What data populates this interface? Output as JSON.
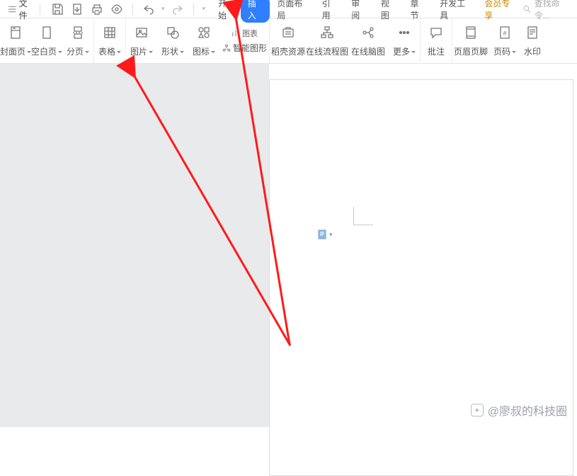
{
  "topbar": {
    "file_label": "文件",
    "search_placeholder": "查找命令..."
  },
  "tabs": {
    "start": "开始",
    "insert": "插入",
    "layout": "页面布局",
    "reference": "引用",
    "review": "审阅",
    "view": "视图",
    "chapter": "章节",
    "devtools": "开发工具",
    "vip": "会员专享"
  },
  "ribbon": {
    "cover": "封面页",
    "blank": "空白页",
    "pagebreak": "分页",
    "table": "表格",
    "picture": "图片",
    "shape": "形状",
    "icon": "图标",
    "chart_small": "图表",
    "smartart": "智能图形",
    "docer": "稻壳资源",
    "flowchart": "在线流程图",
    "mindmap": "在线脑图",
    "more": "更多",
    "comment": "批注",
    "headerfooter": "页眉页脚",
    "pagenum": "页码",
    "watermark": "水印"
  },
  "watermark": {
    "text": "@廖叔的科技圈"
  }
}
